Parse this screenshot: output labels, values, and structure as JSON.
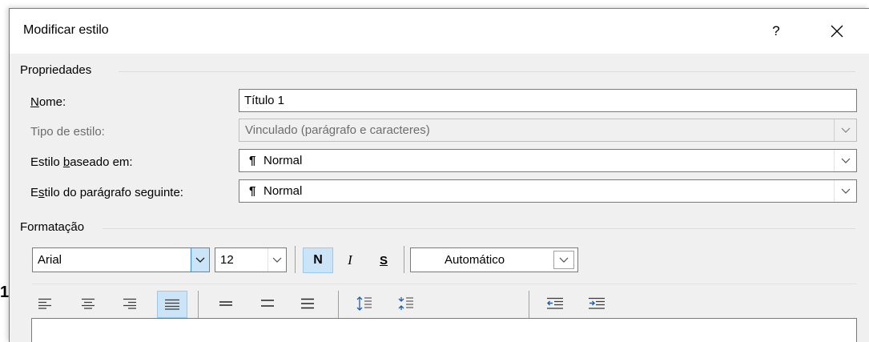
{
  "dialog": {
    "title": "Modificar estilo",
    "help_label": "?",
    "close_icon": "close-icon"
  },
  "properties": {
    "group_label": "Propriedades",
    "name_label_prefix": "N",
    "name_label_rest": "ome:",
    "name_value": "Título 1",
    "style_type_label": "Tipo de estilo:",
    "style_type_value": "Vinculado (parágrafo e caracteres)",
    "based_on_label_a": "Estilo ",
    "based_on_label_u": "b",
    "based_on_label_b": "aseado em:",
    "based_on_value": "Normal",
    "next_para_label_a": "E",
    "next_para_label_u": "s",
    "next_para_label_b": "tilo do parágrafo seguinte:",
    "next_para_value": "Normal",
    "pilcrow": "¶"
  },
  "formatting": {
    "group_label": "Formatação",
    "font_value": "Arial",
    "size_value": "12",
    "bold_label": "N",
    "italic_label": "I",
    "underline_label": "S",
    "color_value": "Automático"
  },
  "toolbar_icons": [
    "align-left-icon",
    "align-center-icon",
    "align-right-icon",
    "justify-icon",
    "single-spacing-icon",
    "one-half-spacing-icon",
    "double-spacing-icon",
    "increase-spacing-before-icon",
    "decrease-spacing-before-icon",
    "decrease-indent-icon",
    "increase-indent-icon"
  ],
  "stray_text": "1",
  "colors": {
    "dialog_bg": "#f0f0f0",
    "selected_bg": "#cce4f7",
    "selected_border": "#99c9ef",
    "accent_blue": "#3c8de0"
  }
}
